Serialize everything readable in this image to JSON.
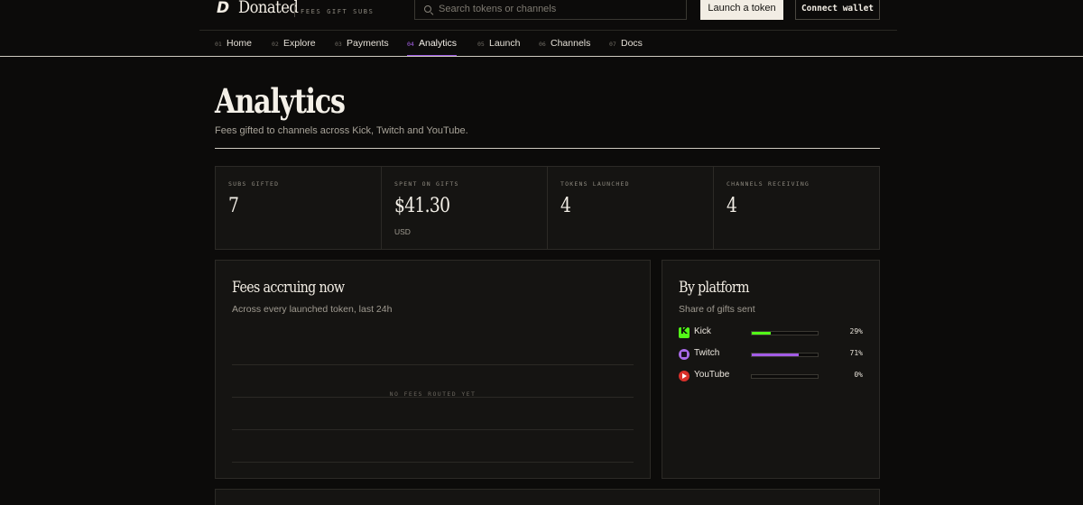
{
  "header": {
    "brand": "Donated",
    "tagline": "FEES GIFT SUBS",
    "search_placeholder": "Search tokens or channels",
    "launch_label": "Launch a token",
    "connect_label": "Connect wallet"
  },
  "nav": {
    "items": [
      {
        "num": "01",
        "label": "Home"
      },
      {
        "num": "02",
        "label": "Explore"
      },
      {
        "num": "03",
        "label": "Payments"
      },
      {
        "num": "04",
        "label": "Analytics",
        "active": true
      },
      {
        "num": "05",
        "label": "Launch"
      },
      {
        "num": "06",
        "label": "Channels"
      },
      {
        "num": "07",
        "label": "Docs"
      }
    ]
  },
  "hero": {
    "title": "Analytics",
    "subtitle": "Fees gifted to channels across Kick, Twitch and YouTube."
  },
  "stats": [
    {
      "label": "SUBS GIFTED",
      "value": "7"
    },
    {
      "label": "SPENT ON GIFTS",
      "value": "$41.30",
      "unit": "USD"
    },
    {
      "label": "TOKENS LAUNCHED",
      "value": "4"
    },
    {
      "label": "CHANNELS RECEIVING",
      "value": "4"
    }
  ],
  "fees_card": {
    "title": "Fees accruing now",
    "subtitle": "Across every launched token, last 24h",
    "empty_note": "NO FEES ROUTED YET"
  },
  "platform_card": {
    "title": "By platform",
    "subtitle": "Share of gifts sent",
    "platforms": [
      {
        "name": "Kick",
        "icon": "kick-icon",
        "percent_label": "29%",
        "share": 0.29,
        "color": "#53fc18"
      },
      {
        "name": "Twitch",
        "icon": "twitch-icon",
        "percent_label": "71%",
        "share": 0.71,
        "color": "#a35ce6"
      },
      {
        "name": "YouTube",
        "icon": "youtube-icon",
        "percent_label": "0%",
        "share": 0.0,
        "color": "#d8302a"
      }
    ]
  },
  "colors": {
    "background": "#0c0b0a",
    "card": "#151412",
    "accent": "#9d5be3"
  }
}
